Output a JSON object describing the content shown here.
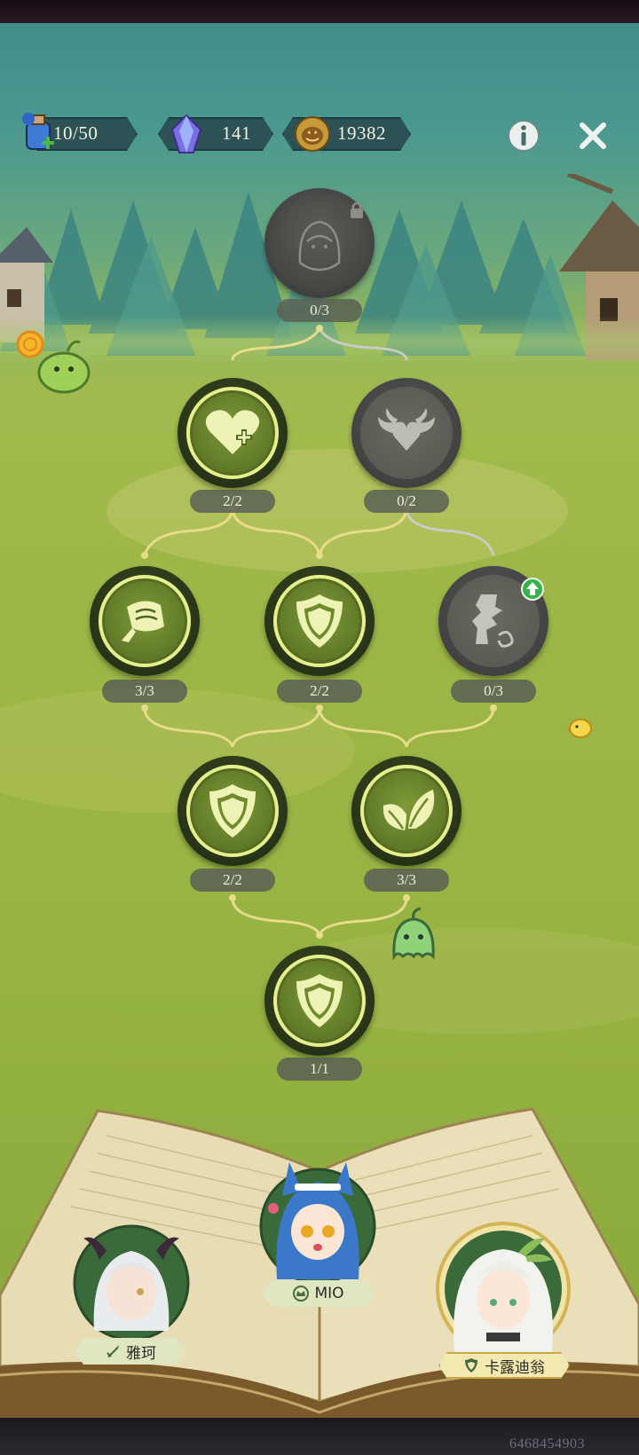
{
  "resources": {
    "stamina": {
      "value": "10/50",
      "icon": "potion-icon"
    },
    "gems": {
      "value": "141",
      "icon": "crystal-icon"
    },
    "coins": {
      "value": "19382",
      "icon": "pumpkin-coin-icon"
    }
  },
  "buttons": {
    "info": "info-icon",
    "close": "close-icon"
  },
  "skill_tree": {
    "nodes": [
      {
        "id": "top",
        "icon": "character-portrait-icon",
        "count": "0/3",
        "state": "locked"
      },
      {
        "id": "r1a",
        "icon": "heart-plus-icon",
        "count": "2/2",
        "state": "active"
      },
      {
        "id": "r1b",
        "icon": "winged-heart-icon",
        "count": "0/2",
        "state": "locked"
      },
      {
        "id": "r2a",
        "icon": "bandage-icon",
        "count": "3/3",
        "state": "active"
      },
      {
        "id": "r2b",
        "icon": "shield-icon",
        "count": "2/2",
        "state": "active"
      },
      {
        "id": "r2c",
        "icon": "broken-column-icon",
        "count": "0/3",
        "state": "locked",
        "badge": "upgrade-arrow-icon"
      },
      {
        "id": "r3a",
        "icon": "shield-icon",
        "count": "2/2",
        "state": "active"
      },
      {
        "id": "r3b",
        "icon": "leaf-icon",
        "count": "3/3",
        "state": "active"
      },
      {
        "id": "r4",
        "icon": "shield-icon",
        "count": "1/1",
        "state": "active"
      }
    ]
  },
  "characters": [
    {
      "name": "雅珂",
      "role_icon": "sword-icon"
    },
    {
      "name": "MIO",
      "role_icon": "crown-icon"
    },
    {
      "name": "卡露迪翁",
      "role_icon": "shield-icon",
      "selected": true
    }
  ],
  "watermark": "6468454903",
  "colors": {
    "active_ring": "#e6ef8e",
    "locked": "#555555",
    "link_active": "#e8dc8a",
    "link_locked": "#c9ccc4"
  }
}
